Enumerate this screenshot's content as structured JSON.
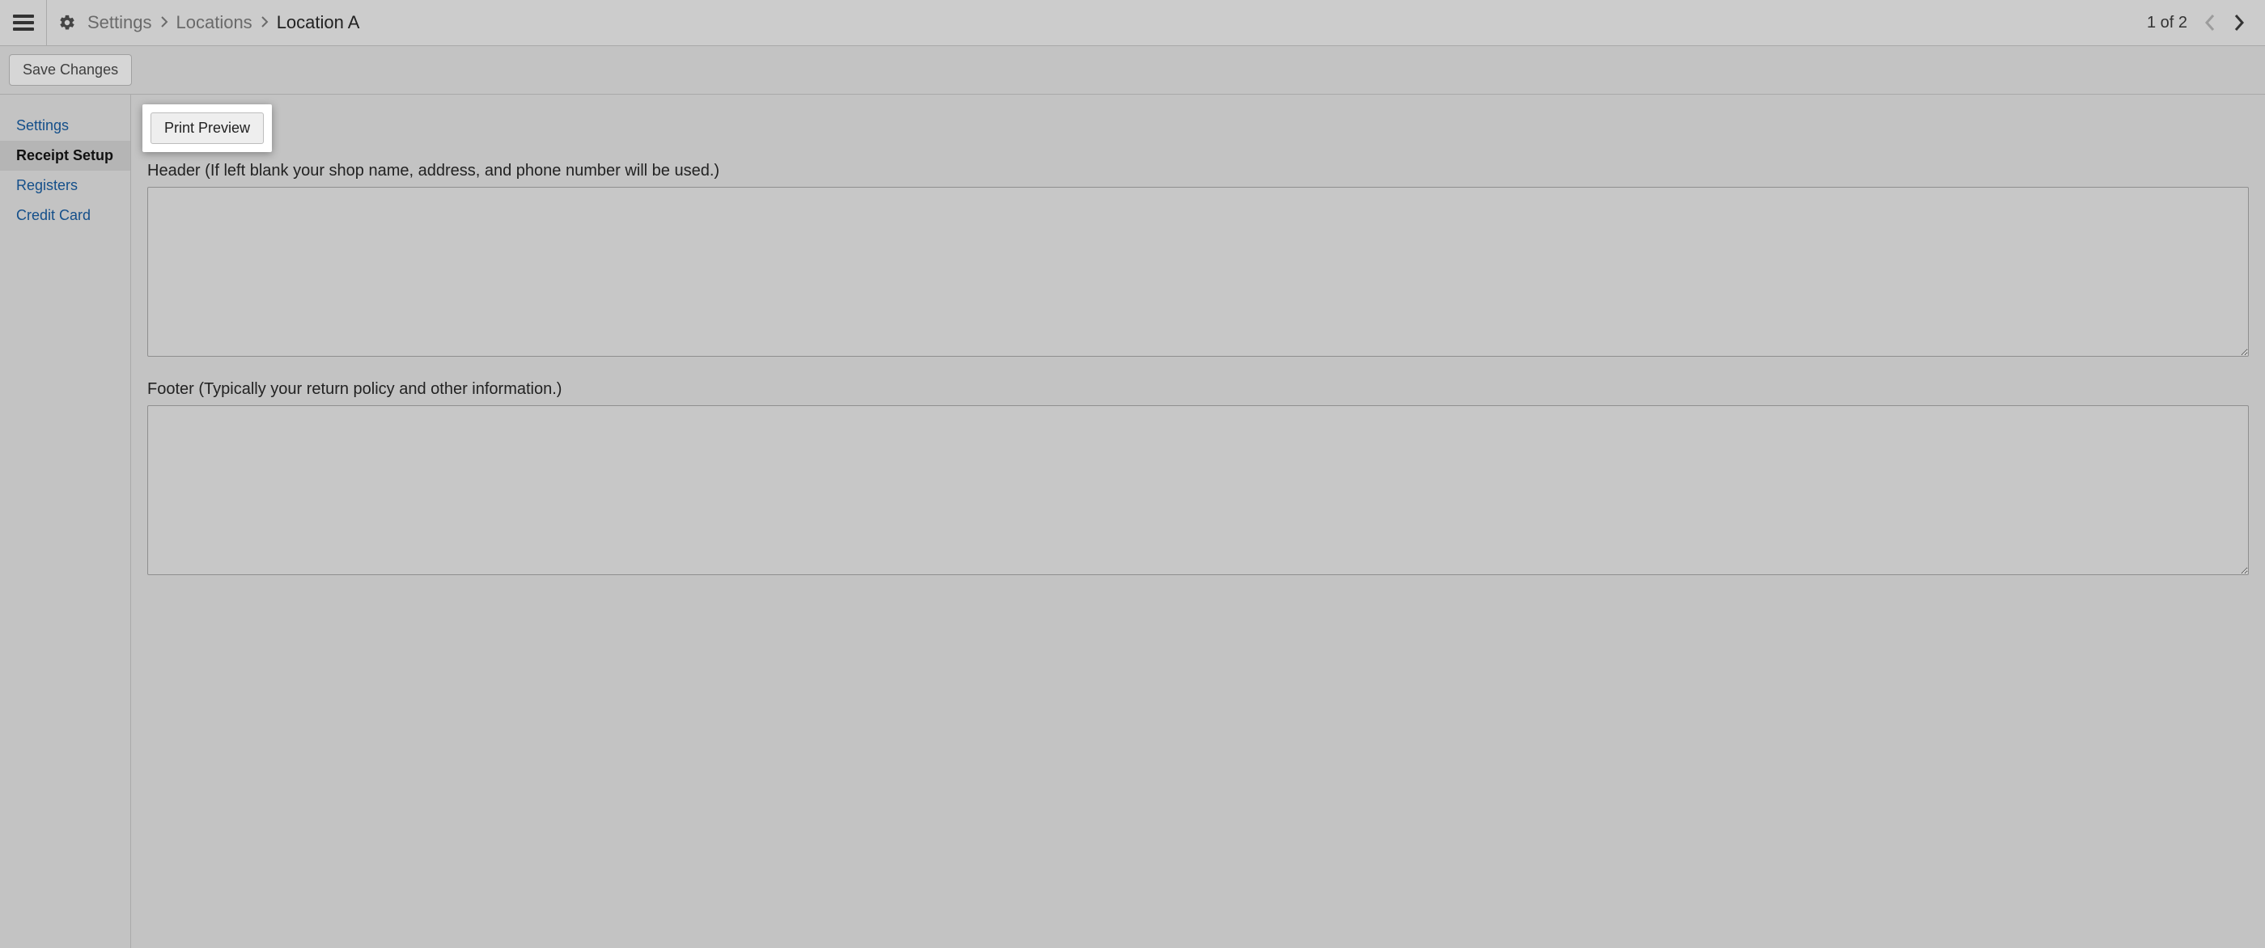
{
  "header": {
    "breadcrumbs": {
      "settings": "Settings",
      "locations": "Locations",
      "current": "Location A"
    },
    "pager": {
      "text": "1 of 2"
    }
  },
  "toolbar": {
    "save_label": "Save Changes"
  },
  "sidebar": {
    "items": [
      {
        "label": "Settings",
        "active": false
      },
      {
        "label": "Receipt Setup",
        "active": true
      },
      {
        "label": "Registers",
        "active": false
      },
      {
        "label": "Credit Card",
        "active": false
      }
    ]
  },
  "main": {
    "print_preview_label": "Print Preview",
    "header_label": "Header (If left blank your shop name, address, and phone number will be used.)",
    "header_value": "",
    "footer_label": "Footer (Typically your return policy and other information.)",
    "footer_value": ""
  }
}
